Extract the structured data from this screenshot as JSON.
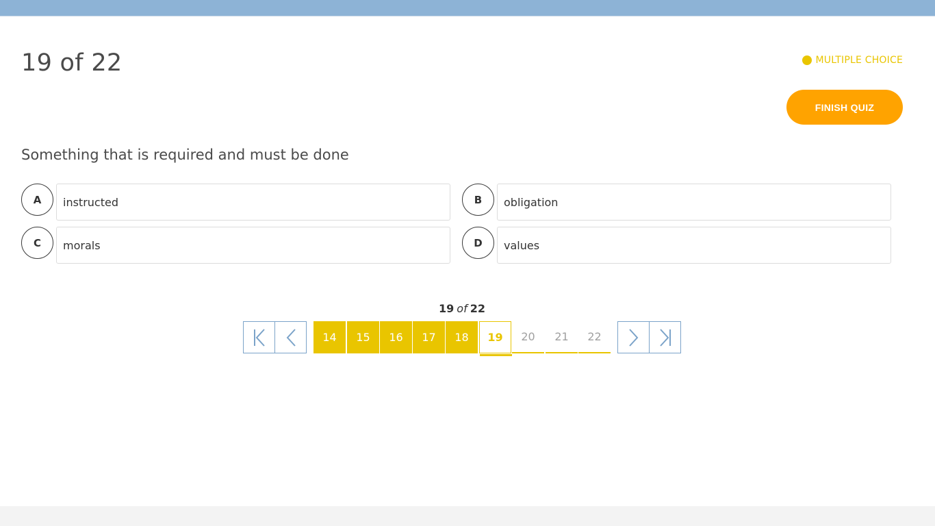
{
  "header": {
    "counter": "19 of 22",
    "question_type": "MULTIPLE CHOICE",
    "finish_label": "FINISH QUIZ"
  },
  "question": {
    "text": "Something that is required and must be done",
    "options": [
      {
        "letter": "A",
        "text": "instructed"
      },
      {
        "letter": "B",
        "text": "obligation"
      },
      {
        "letter": "C",
        "text": "morals"
      },
      {
        "letter": "D",
        "text": "values"
      }
    ]
  },
  "pager": {
    "current": "19",
    "of_word": "of",
    "total": "22",
    "pages": [
      {
        "label": "14",
        "state": "done"
      },
      {
        "label": "15",
        "state": "done"
      },
      {
        "label": "16",
        "state": "done"
      },
      {
        "label": "17",
        "state": "done"
      },
      {
        "label": "18",
        "state": "done"
      },
      {
        "label": "19",
        "state": "current"
      },
      {
        "label": "20",
        "state": "todo"
      },
      {
        "label": "21",
        "state": "todo"
      },
      {
        "label": "22",
        "state": "todo"
      }
    ]
  },
  "colors": {
    "accent_yellow": "#e9c500",
    "finish_orange": "#ffa300",
    "nav_blue": "#7ba3c9",
    "top_bar": "#8db3d6"
  }
}
